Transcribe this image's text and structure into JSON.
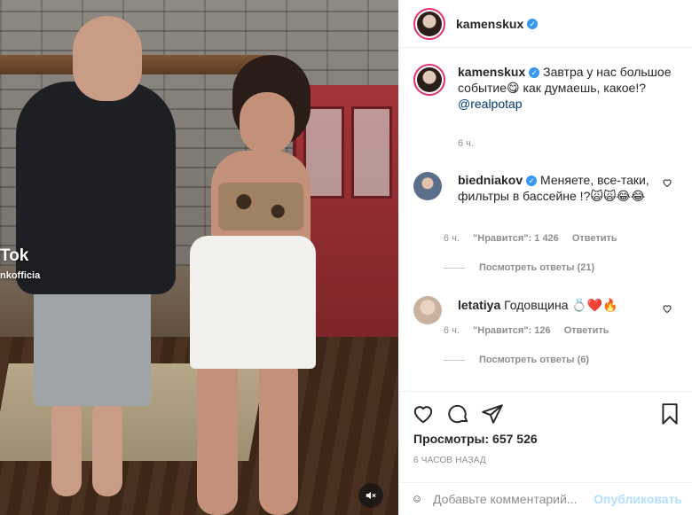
{
  "video": {
    "watermark_brand": "Tok",
    "watermark_handle": "nkofficia",
    "mute_icon": "speaker-muted-icon"
  },
  "post": {
    "author": "kamenskux",
    "verified": "✓"
  },
  "caption": {
    "username": "kamenskux",
    "text": "Завтра у нас большое событие😋 как думаешь, какое!?",
    "mention": "@realpotap",
    "time": "6 ч."
  },
  "comments": [
    {
      "username": "biedniakov",
      "text": "Меняете, все-таки, фильтры в бассейне !?🙀🙀😂😂",
      "time": "6 ч.",
      "likes": "\"Нравится\": 1 426",
      "reply": "Ответить",
      "view_replies": "Посмотреть ответы (21)"
    },
    {
      "username": "letatiya",
      "text": "Годовщина 💍❤️🔥",
      "time": "6 ч.",
      "likes": "\"Нравится\": 126",
      "reply": "Ответить",
      "view_replies": "Посмотреть ответы (6)"
    }
  ],
  "stats": {
    "views": "Просмотры: 657 526",
    "posted_ago": "6 ЧАСОВ НАЗАД"
  },
  "add_comment": {
    "placeholder": "Добавьте комментарий...",
    "publish": "Опубликовать"
  },
  "colors": {
    "accent": "#3897f0",
    "link": "#00376b",
    "muted": "#8e8e8e",
    "publish_disabled": "#b2dffc"
  }
}
